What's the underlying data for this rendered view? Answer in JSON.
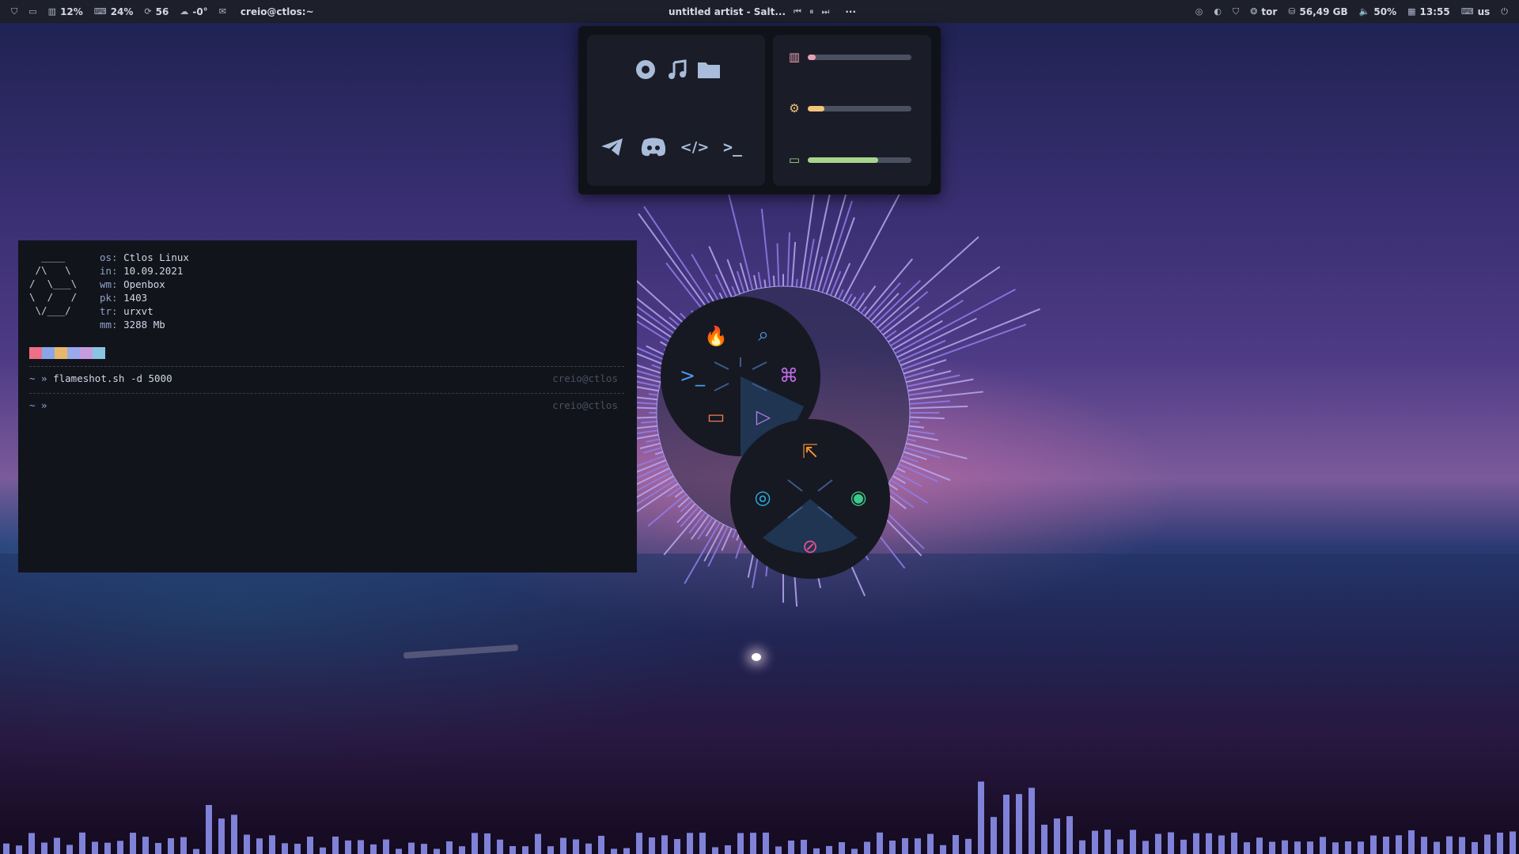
{
  "topbar": {
    "left": [
      {
        "icon": "shield-icon",
        "text": ""
      },
      {
        "icon": "monitor-icon",
        "text": ""
      },
      {
        "icon": "memory-icon",
        "text": "12%"
      },
      {
        "icon": "keyboard-icon",
        "text": "24%"
      },
      {
        "icon": "refresh-icon",
        "text": "56"
      },
      {
        "icon": "cloud-icon",
        "text": "-0°"
      },
      {
        "icon": "mail-icon",
        "text": ""
      }
    ],
    "window_title": "creio@ctlos:~",
    "now_playing": "untitled artist - Salt...",
    "more": "···",
    "right": [
      {
        "icon": "eye-icon",
        "text": ""
      },
      {
        "icon": "contrast-icon",
        "text": ""
      },
      {
        "icon": "vpn-shield-icon",
        "text": ""
      },
      {
        "icon": "tor-icon",
        "text": "tor"
      },
      {
        "icon": "disk-icon",
        "text": "56,49 GB"
      },
      {
        "icon": "volume-icon",
        "text": "50%"
      },
      {
        "icon": "calendar-icon",
        "text": "13:55"
      },
      {
        "icon": "keyboard-layout-icon",
        "text": "us"
      },
      {
        "icon": "power-icon",
        "text": ""
      }
    ]
  },
  "launcher": {
    "apps": [
      {
        "name": "firefox-icon",
        "glyph": "◐"
      },
      {
        "name": "music-icon",
        "glyph": "♫"
      },
      {
        "name": "folder-icon",
        "glyph": "▬"
      },
      {
        "name": "telegram-icon",
        "glyph": "➤"
      },
      {
        "name": "discord-icon",
        "glyph": "☻"
      },
      {
        "name": "code-icon",
        "glyph": "</>"
      },
      {
        "name": "terminal-icon",
        "glyph": ">_"
      }
    ],
    "meters": [
      {
        "name": "memory",
        "icon": "memory-chip-icon",
        "color": "#e8a0b6",
        "level": 0.08
      },
      {
        "name": "cpu",
        "icon": "cpu-icon",
        "color": "#f2c57a",
        "level": 0.16
      },
      {
        "name": "disk",
        "icon": "drive-icon",
        "color": "#a9d38d",
        "level": 0.68
      }
    ]
  },
  "terminal": {
    "ascii_art": "  ____\n /\\   \\\n/  \\___\\\n\\  /   /\n \\/___/",
    "info": [
      {
        "key": "os:",
        "value": "Ctlos Linux"
      },
      {
        "key": "in:",
        "value": "10.09.2021"
      },
      {
        "key": "wm:",
        "value": "Openbox"
      },
      {
        "key": "pk:",
        "value": "1403"
      },
      {
        "key": "tr:",
        "value": "urxvt"
      },
      {
        "key": "mm:",
        "value": "3288 Mb"
      }
    ],
    "palette": [
      "#ee6f86",
      "#8aa6e8",
      "#e7b86a",
      "#9aa8ec",
      "#c79be0",
      "#88c5e0"
    ],
    "line1_prompt": "~ »",
    "line1_cmd": "flameshot.sh -d 5000",
    "line2_prompt": "~ »",
    "host": "creio@ctlos"
  },
  "radial_menu_1": {
    "items": [
      {
        "name": "firefox-radial-icon",
        "glyph": "🔥",
        "color": "#f07a55"
      },
      {
        "name": "search-radial-icon",
        "glyph": "⌕",
        "color": "#4f9bf2"
      },
      {
        "name": "terminal-radial-icon",
        "glyph": ">_",
        "color": "#4f9bf2"
      },
      {
        "name": "command-radial-icon",
        "glyph": "⌘",
        "color": "#c06ae8"
      },
      {
        "name": "folder-radial-icon",
        "glyph": "▭",
        "color": "#f07a55"
      },
      {
        "name": "play-radial-icon",
        "glyph": "▷",
        "color": "#b67ae8"
      }
    ]
  },
  "radial_menu_2": {
    "items": [
      {
        "name": "select-area-icon",
        "glyph": "⇱",
        "color": "#f0922f"
      },
      {
        "name": "screenshot-icon",
        "glyph": "◎",
        "color": "#29b4e8"
      },
      {
        "name": "record-icon",
        "glyph": "◉",
        "color": "#3cc98a"
      },
      {
        "name": "gif-capture-icon",
        "glyph": "⊘",
        "color": "#e84f8f"
      }
    ]
  }
}
